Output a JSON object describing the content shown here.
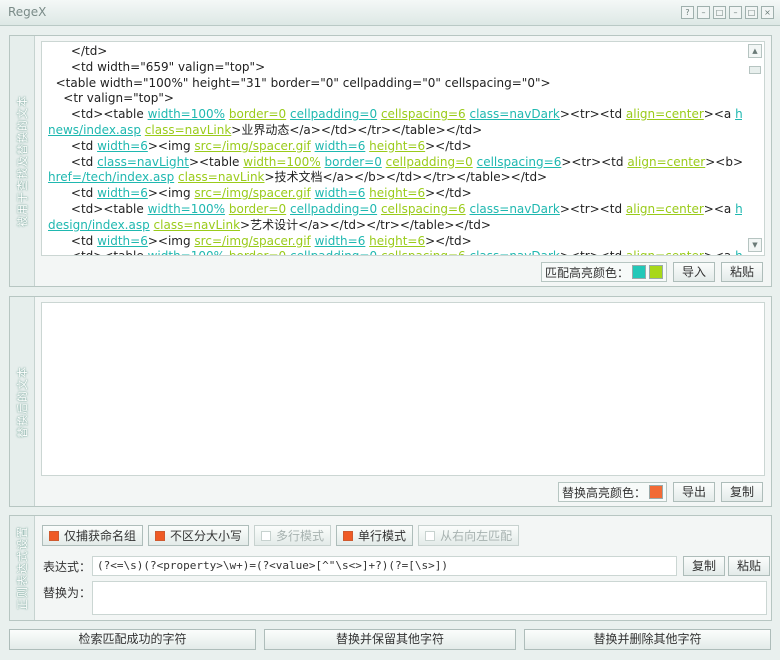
{
  "window": {
    "title": "RegeX",
    "controls": [
      "?",
      "–",
      "□",
      "–",
      "□",
      "×"
    ]
  },
  "source": {
    "side_label": "被用于查找及替换的文本",
    "lines": [
      [
        {
          "t": "      </td>"
        }
      ],
      [
        {
          "t": "      <td width=\"659\" valign=\"top\">"
        }
      ],
      [
        {
          "t": "  <table width=\"100%\" height=\"31\" border=\"0\" cellpadding=\"0\" cellspacing=\"0\">"
        }
      ],
      [
        {
          "t": "    <tr valign=\"top\">"
        }
      ],
      [
        {
          "t": "      <td><table "
        },
        {
          "t": "width=100%",
          "h": "c"
        },
        {
          "t": " "
        },
        {
          "t": "border=0",
          "h": "g"
        },
        {
          "t": " "
        },
        {
          "t": "cellpadding=0",
          "h": "c"
        },
        {
          "t": " "
        },
        {
          "t": "cellspacing=6",
          "h": "g"
        },
        {
          "t": " "
        },
        {
          "t": "class=navDark",
          "h": "c"
        },
        {
          "t": "><tr><td "
        },
        {
          "t": "align=center",
          "h": "g"
        },
        {
          "t": "><a "
        },
        {
          "t": "href=/",
          "h": "c"
        }
      ],
      [
        {
          "t": "news/index.asp",
          "h": "c"
        },
        {
          "t": " "
        },
        {
          "t": "class=navLink",
          "h": "g"
        },
        {
          "t": ">业界动态</a></td></tr></table></td>"
        }
      ],
      [
        {
          "t": "      <td "
        },
        {
          "t": "width=6",
          "h": "c"
        },
        {
          "t": "><img "
        },
        {
          "t": "src=/img/spacer.gif",
          "h": "g"
        },
        {
          "t": " "
        },
        {
          "t": "width=6",
          "h": "c"
        },
        {
          "t": " "
        },
        {
          "t": "height=6",
          "h": "g"
        },
        {
          "t": "></td>"
        }
      ],
      [
        {
          "t": "      <td "
        },
        {
          "t": "class=navLight",
          "h": "c"
        },
        {
          "t": "><table "
        },
        {
          "t": "width=100%",
          "h": "g"
        },
        {
          "t": " "
        },
        {
          "t": "border=0",
          "h": "c"
        },
        {
          "t": " "
        },
        {
          "t": "cellpadding=0",
          "h": "g"
        },
        {
          "t": " "
        },
        {
          "t": "cellspacing=6",
          "h": "c"
        },
        {
          "t": "><tr><td "
        },
        {
          "t": "align=center",
          "h": "g"
        },
        {
          "t": "><b><a"
        }
      ],
      [
        {
          "t": "href=/tech/index.asp",
          "h": "c"
        },
        {
          "t": " "
        },
        {
          "t": "class=navLink",
          "h": "g"
        },
        {
          "t": ">技术文档</a></b></td></tr></table></td>"
        }
      ],
      [
        {
          "t": "      <td "
        },
        {
          "t": "width=6",
          "h": "c"
        },
        {
          "t": "><img "
        },
        {
          "t": "src=/img/spacer.gif",
          "h": "g"
        },
        {
          "t": " "
        },
        {
          "t": "width=6",
          "h": "c"
        },
        {
          "t": " "
        },
        {
          "t": "height=6",
          "h": "g"
        },
        {
          "t": "></td>"
        }
      ],
      [
        {
          "t": "      <td><table "
        },
        {
          "t": "width=100%",
          "h": "c"
        },
        {
          "t": " "
        },
        {
          "t": "border=0",
          "h": "g"
        },
        {
          "t": " "
        },
        {
          "t": "cellpadding=0",
          "h": "c"
        },
        {
          "t": " "
        },
        {
          "t": "cellspacing=6",
          "h": "g"
        },
        {
          "t": " "
        },
        {
          "t": "class=navDark",
          "h": "c"
        },
        {
          "t": "><tr><td "
        },
        {
          "t": "align=center",
          "h": "g"
        },
        {
          "t": "><a "
        },
        {
          "t": "href=/",
          "h": "c"
        }
      ],
      [
        {
          "t": "design/index.asp",
          "h": "c"
        },
        {
          "t": " "
        },
        {
          "t": "class=navLink",
          "h": "g"
        },
        {
          "t": ">艺术设计</a></td></tr></table></td>"
        }
      ],
      [
        {
          "t": "      <td "
        },
        {
          "t": "width=6",
          "h": "c"
        },
        {
          "t": "><img "
        },
        {
          "t": "src=/img/spacer.gif",
          "h": "g"
        },
        {
          "t": " "
        },
        {
          "t": "width=6",
          "h": "c"
        },
        {
          "t": " "
        },
        {
          "t": "height=6",
          "h": "g"
        },
        {
          "t": "></td>"
        }
      ],
      [
        {
          "t": "      <td><table "
        },
        {
          "t": "width=100%",
          "h": "c"
        },
        {
          "t": " "
        },
        {
          "t": "border=0",
          "h": "g"
        },
        {
          "t": " "
        },
        {
          "t": "cellpadding=0",
          "h": "c"
        },
        {
          "t": " "
        },
        {
          "t": "cellspacing=6",
          "h": "g"
        },
        {
          "t": " "
        },
        {
          "t": "class=navDark",
          "h": "c"
        },
        {
          "t": "><tr><td "
        },
        {
          "t": "align=center",
          "h": "g"
        },
        {
          "t": "><a "
        },
        {
          "t": "href=/",
          "h": "c"
        }
      ]
    ],
    "match_color_label": "匹配高亮颜色：",
    "match_colors": [
      "#22c8b8",
      "#a8d81a"
    ],
    "import_label": "导入",
    "paste_label": "粘贴"
  },
  "result": {
    "side_label": "替换后的文本",
    "replace_color_label": "替换高亮颜色：",
    "replace_color": "#f26a35",
    "export_label": "导出",
    "copy_label": "复制"
  },
  "regex": {
    "side_label": "正则表达式设置",
    "options": [
      {
        "label": "仅捕获命名组",
        "checked": true
      },
      {
        "label": "不区分大小写",
        "checked": true
      },
      {
        "label": "多行模式",
        "checked": false
      },
      {
        "label": "单行模式",
        "checked": true
      },
      {
        "label": "从右向左匹配",
        "checked": false
      }
    ],
    "expression_label": "表达式：",
    "expression_value": "(?<=\\s)(?<property>\\w+)=(?<value>[^\"\\s<>]+?)(?=[\\s>])",
    "copy_label": "复制",
    "paste_label": "粘贴",
    "replace_label": "替换为：",
    "replace_value": ""
  },
  "actions": {
    "find": "检索匹配成功的字符",
    "replace_keep": "替换并保留其他字符",
    "replace_delete": "替换并删除其他字符"
  }
}
